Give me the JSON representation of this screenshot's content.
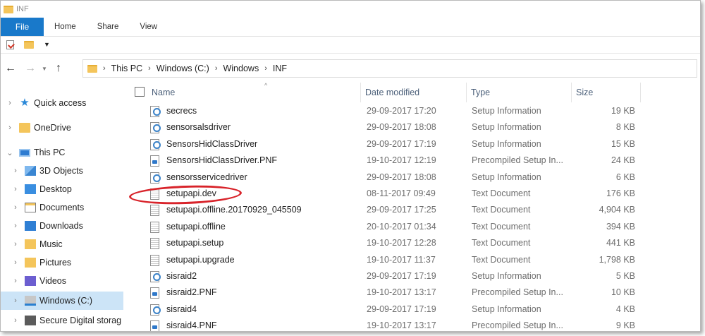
{
  "window": {
    "title": "INF"
  },
  "ribbon": {
    "tabs": [
      "File",
      "Home",
      "Share",
      "View"
    ]
  },
  "address": {
    "crumbs": [
      "This PC",
      "Windows (C:)",
      "Windows",
      "INF"
    ]
  },
  "navpane": {
    "items": [
      {
        "label": "Quick access",
        "icon": "star-icon"
      },
      {
        "label": "OneDrive",
        "icon": "onedrive-folder-icon"
      },
      {
        "label": "This PC",
        "icon": "computer-icon"
      },
      {
        "label": "3D Objects",
        "icon": "3d-objects-icon"
      },
      {
        "label": "Desktop",
        "icon": "desktop-icon"
      },
      {
        "label": "Documents",
        "icon": "documents-icon"
      },
      {
        "label": "Downloads",
        "icon": "downloads-icon"
      },
      {
        "label": "Music",
        "icon": "music-icon"
      },
      {
        "label": "Pictures",
        "icon": "pictures-icon"
      },
      {
        "label": "Videos",
        "icon": "videos-icon"
      },
      {
        "label": "Windows (C:)",
        "icon": "drive-icon"
      },
      {
        "label": "Secure Digital storag",
        "icon": "sd-card-icon"
      }
    ]
  },
  "columns": {
    "name": "Name",
    "date": "Date modified",
    "type": "Type",
    "size": "Size"
  },
  "files": [
    {
      "name": "secrecs",
      "date": "29-09-2017 17:20",
      "type": "Setup Information",
      "size": "19 KB",
      "icon": "inf-file-icon"
    },
    {
      "name": "sensorsalsdriver",
      "date": "29-09-2017 18:08",
      "type": "Setup Information",
      "size": "8 KB",
      "icon": "inf-file-icon"
    },
    {
      "name": "SensorsHidClassDriver",
      "date": "29-09-2017 17:19",
      "type": "Setup Information",
      "size": "15 KB",
      "icon": "inf-file-icon"
    },
    {
      "name": "SensorsHidClassDriver.PNF",
      "date": "19-10-2017 12:19",
      "type": "Precompiled Setup In...",
      "size": "24 KB",
      "icon": "pnf-file-icon"
    },
    {
      "name": "sensorsservicedriver",
      "date": "29-09-2017 18:08",
      "type": "Setup Information",
      "size": "6 KB",
      "icon": "inf-file-icon"
    },
    {
      "name": "setupapi.dev",
      "date": "08-11-2017 09:49",
      "type": "Text Document",
      "size": "176 KB",
      "icon": "text-file-icon"
    },
    {
      "name": "setupapi.offline.20170929_045509",
      "date": "29-09-2017 17:25",
      "type": "Text Document",
      "size": "4,904 KB",
      "icon": "text-file-icon"
    },
    {
      "name": "setupapi.offline",
      "date": "20-10-2017 01:34",
      "type": "Text Document",
      "size": "394 KB",
      "icon": "text-file-icon"
    },
    {
      "name": "setupapi.setup",
      "date": "19-10-2017 12:28",
      "type": "Text Document",
      "size": "441 KB",
      "icon": "text-file-icon"
    },
    {
      "name": "setupapi.upgrade",
      "date": "19-10-2017 11:37",
      "type": "Text Document",
      "size": "1,798 KB",
      "icon": "text-file-icon"
    },
    {
      "name": "sisraid2",
      "date": "29-09-2017 17:19",
      "type": "Setup Information",
      "size": "5 KB",
      "icon": "inf-file-icon"
    },
    {
      "name": "sisraid2.PNF",
      "date": "19-10-2017 13:17",
      "type": "Precompiled Setup In...",
      "size": "10 KB",
      "icon": "pnf-file-icon"
    },
    {
      "name": "sisraid4",
      "date": "29-09-2017 17:19",
      "type": "Setup Information",
      "size": "4 KB",
      "icon": "inf-file-icon"
    },
    {
      "name": "sisraid4.PNF",
      "date": "19-10-2017 13:17",
      "type": "Precompiled Setup In...",
      "size": "9 KB",
      "icon": "pnf-file-icon"
    }
  ],
  "colors": {
    "accent": "#1979ca",
    "selection": "#cce4f7",
    "highlight_ellipse": "#d8232a"
  }
}
